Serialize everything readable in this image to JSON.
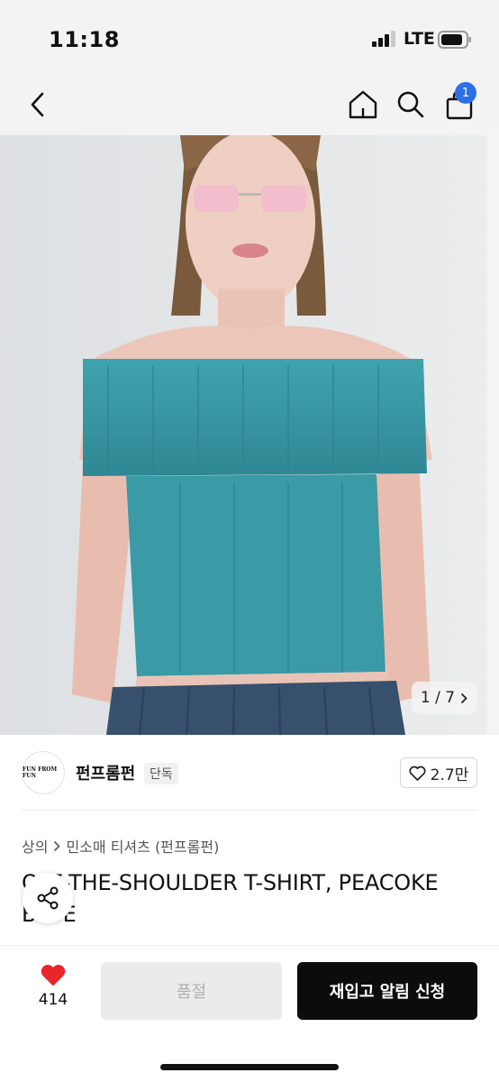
{
  "status_bar": {
    "time": "11:18",
    "network": "LTE"
  },
  "nav": {
    "cart_badge": "1",
    "icons": [
      "chevron-left-icon",
      "home-icon",
      "search-icon",
      "shopping-bag-icon"
    ]
  },
  "gallery": {
    "current": "1",
    "total": "7",
    "separator": " / ",
    "counter_text": "1 / 7"
  },
  "brand": {
    "logo_text": "FUN FROM FUN",
    "name": "펀프롬펀",
    "tag": "단독",
    "likes": "2.7만"
  },
  "breadcrumb": {
    "category": "상의",
    "subcategory": "민소매 티셔츠 (펀프롬펀)"
  },
  "product": {
    "title": "OFF-THE-SHOULDER T-SHIRT, PEACOKE BLUE"
  },
  "actions": {
    "wish_count": "414",
    "soldout_label": "품절",
    "restock_label": "재입고 알림 신청"
  },
  "colors": {
    "badge": "#2c6fe6",
    "heart": "#e8262c",
    "garment": "#3a9aa6",
    "primary_button": "#0c0c0c"
  }
}
